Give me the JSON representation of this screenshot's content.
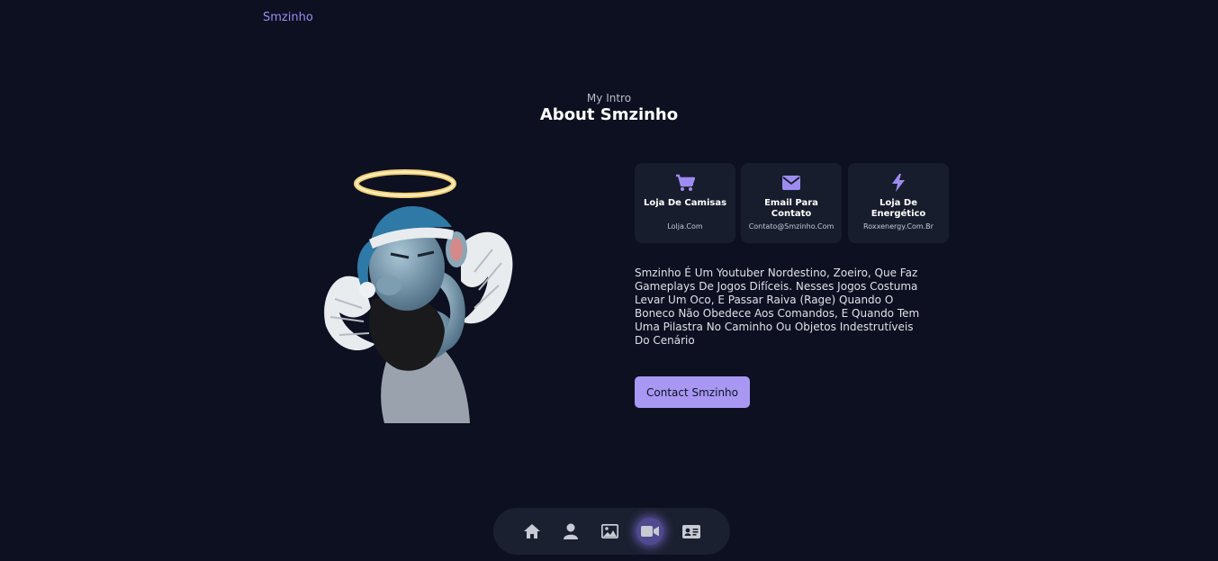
{
  "header": {
    "logo_text": "Smzinho"
  },
  "intro": {
    "subtitle": "My Intro",
    "title": "About Smzinho"
  },
  "cards": [
    {
      "icon": "cart-icon",
      "label": "Loja De Camisas",
      "sub": "Lolja.Com"
    },
    {
      "icon": "envelope-icon",
      "label": "Email Para Contato",
      "sub": "Contato@Smzinho.Com"
    },
    {
      "icon": "bolt-icon",
      "label": "Loja De Energético",
      "sub": "Roxxenergy.Com.Br"
    }
  ],
  "about_text": "Smzinho É Um Youtuber Nordestino, Zoeiro, Que Faz Gameplays De Jogos Difíceis. Nesses Jogos Costuma Levar Um Oco, E Passar Raiva (Rage) Quando O Boneco Não Obedece Aos Comandos, E Quando Tem Uma Pilastra No Caminho Ou Objetos Indestrutíveis Do Cenário",
  "contact_button": "Contact Smzinho",
  "nav": {
    "items": [
      {
        "icon": "home-icon"
      },
      {
        "icon": "user-icon"
      },
      {
        "icon": "image-icon"
      },
      {
        "icon": "video-camera-icon",
        "active": true
      },
      {
        "icon": "contact-card-icon"
      }
    ]
  },
  "colors": {
    "background": "#0c1020",
    "card_background": "#181d2d",
    "accent": "#a898f3",
    "icon_accent": "#9d8cf0",
    "nav_icon": "#c8cad4"
  }
}
